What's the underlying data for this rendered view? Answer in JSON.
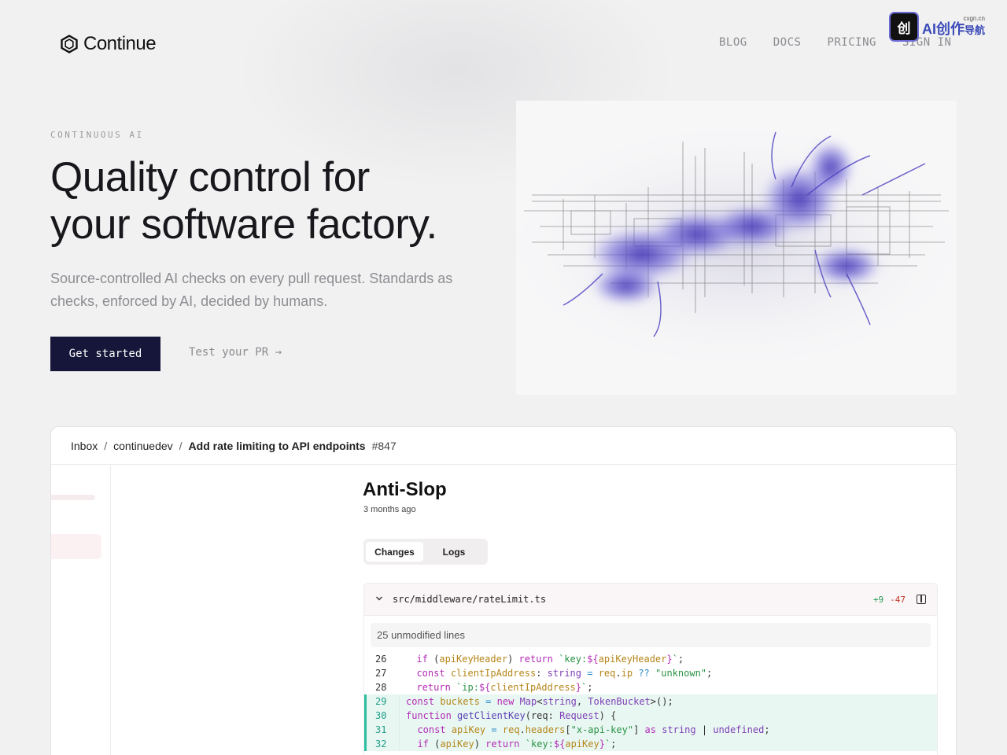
{
  "header": {
    "logo_text": "Continue",
    "nav": [
      "BLOG",
      "DOCS",
      "PRICING",
      "SIGN IN"
    ],
    "badge": {
      "mark": "创",
      "text": "AI创作",
      "sub_top": "cxgn.cn",
      "sub": "导航"
    }
  },
  "hero": {
    "eyebrow": "CONTINUOUS AI",
    "headline_1": "Quality control for",
    "headline_2": "your software factory.",
    "subtitle": "Source-controlled AI checks on every pull request. Standards as checks, enforced by AI, decided by humans.",
    "primary_cta": "Get started",
    "secondary_cta": "Test your PR →"
  },
  "app": {
    "breadcrumb": [
      "Inbox",
      "continuedev",
      "Add rate limiting to API endpoints"
    ],
    "breadcrumb_sep": "/",
    "pr_number": "#847",
    "check": {
      "title": "Anti-Slop",
      "time": "3 months ago"
    },
    "tabs": [
      "Changes",
      "Logs"
    ],
    "diff": {
      "file": "src/middleware/rateLimit.ts",
      "additions": "+9",
      "deletions": "-47",
      "unmodified": "25 unmodified lines",
      "lines": [
        {
          "n": "26",
          "added": false
        },
        {
          "n": "27",
          "added": false
        },
        {
          "n": "28",
          "added": false
        },
        {
          "n": "29",
          "added": true
        },
        {
          "n": "30",
          "added": true
        },
        {
          "n": "31",
          "added": true
        },
        {
          "n": "32",
          "added": true
        }
      ]
    }
  },
  "colors": {
    "primary_button": "#16163a",
    "added_bg": "#e8f7f2",
    "added_border": "#2bbfa0",
    "additions": "#2a9d5c",
    "deletions": "#c0392b"
  }
}
